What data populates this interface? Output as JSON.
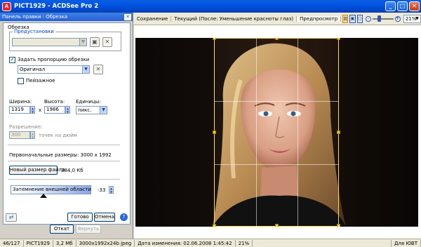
{
  "window": {
    "title": "PICT1929 - ACDSee Pro 2"
  },
  "panel": {
    "title": "Панель правки : Обрезка",
    "section": "Обрезка",
    "presets": {
      "legend": "Предустановки",
      "value": ""
    },
    "ratio_checkbox": {
      "label": "Задать пропорцию обрезки",
      "checked": true
    },
    "ratio_value": "Оригинал",
    "landscape": {
      "label": "Пейзажное",
      "checked": false
    },
    "width": {
      "label": "Ширина:",
      "value": "1319"
    },
    "times": "x",
    "height": {
      "label": "Высота:",
      "value": "1986"
    },
    "units": {
      "label": "Единицы:",
      "value": "пикс."
    },
    "resolution": {
      "label": "Разрешение:",
      "value": "300",
      "suffix": "точек на дюйм"
    },
    "original_size": "Первоначальные размеры: 3000 x 1992",
    "new_size_button": "Новый размер файла",
    "new_size_value": "384,0 Кб",
    "darken": {
      "label": "Затемнение внешней области",
      "value": "-33",
      "level_percent": 33
    },
    "buttons": {
      "done": "Готово",
      "cancel": "Отмена",
      "undo": "Откат",
      "redo": "Вернуть",
      "help": "?"
    }
  },
  "viewer": {
    "tabs": [
      "Сохранение",
      "Текущий (После: Уменьшение красноты глаз)",
      "Предпросмотр"
    ],
    "zoom": "21%"
  },
  "status": {
    "items": [
      "46/127",
      "PICT1929",
      "3,2 Мб",
      "3000x1992x24b jpeg",
      "Дата изменения: 02.06.2008 1:45:42",
      "21%",
      "",
      "Для ЮВТ"
    ]
  },
  "colors": {
    "titlebar": "#0054e3",
    "crop_handles": "#ffd21f",
    "panel_bg": "#d4d0c8"
  }
}
